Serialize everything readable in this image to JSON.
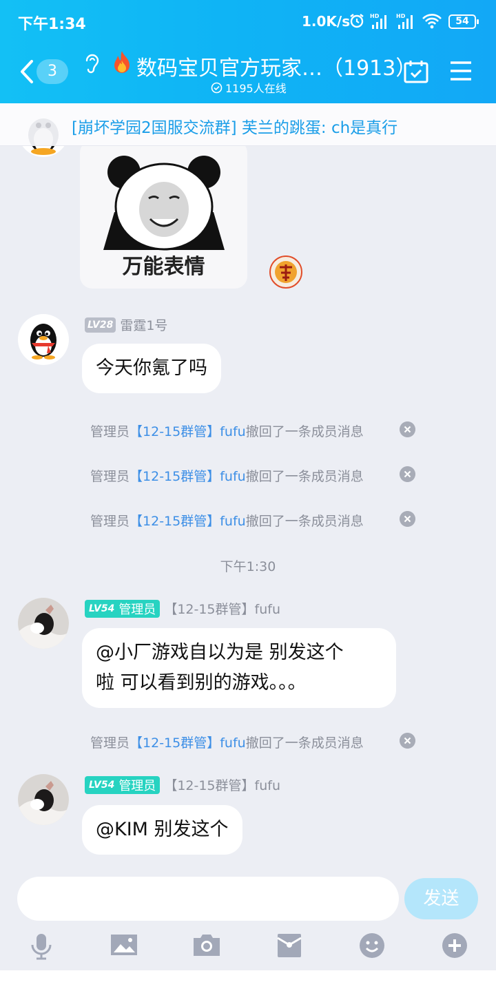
{
  "status_bar": {
    "time": "下午1:34",
    "net_speed": "1.0K/s",
    "signal_label": "HD",
    "battery": "54"
  },
  "header": {
    "unread_count": "3",
    "title": "数码宝贝官方玩家…（1913）",
    "online": "1195人在线"
  },
  "banner": {
    "text": "[崩坏学园2国服交流群] 芙兰的跳蛋: ch是真行"
  },
  "messages": {
    "sticker_caption": "万能表情",
    "msg1": {
      "level": "LV28",
      "name": "雷霆1号",
      "text": "今天你氪了吗"
    },
    "recall_prefix": "管理员",
    "recall_name": "【12-15群管】fufu",
    "recall_suffix": "撤回了一条成员消息",
    "timestamp": "下午1:30",
    "msg2": {
      "level": "LV54",
      "role": "管理员",
      "name": "【12-15群管】fufu",
      "line1": "@小厂游戏自以为是 别发这个",
      "line2": "啦  可以看到别的游戏。。。"
    },
    "msg3": {
      "level": "LV54",
      "role": "管理员",
      "name": "【12-15群管】fufu",
      "text": "@KIM 别发这个"
    }
  },
  "input": {
    "placeholder": "",
    "send_label": "发送"
  }
}
